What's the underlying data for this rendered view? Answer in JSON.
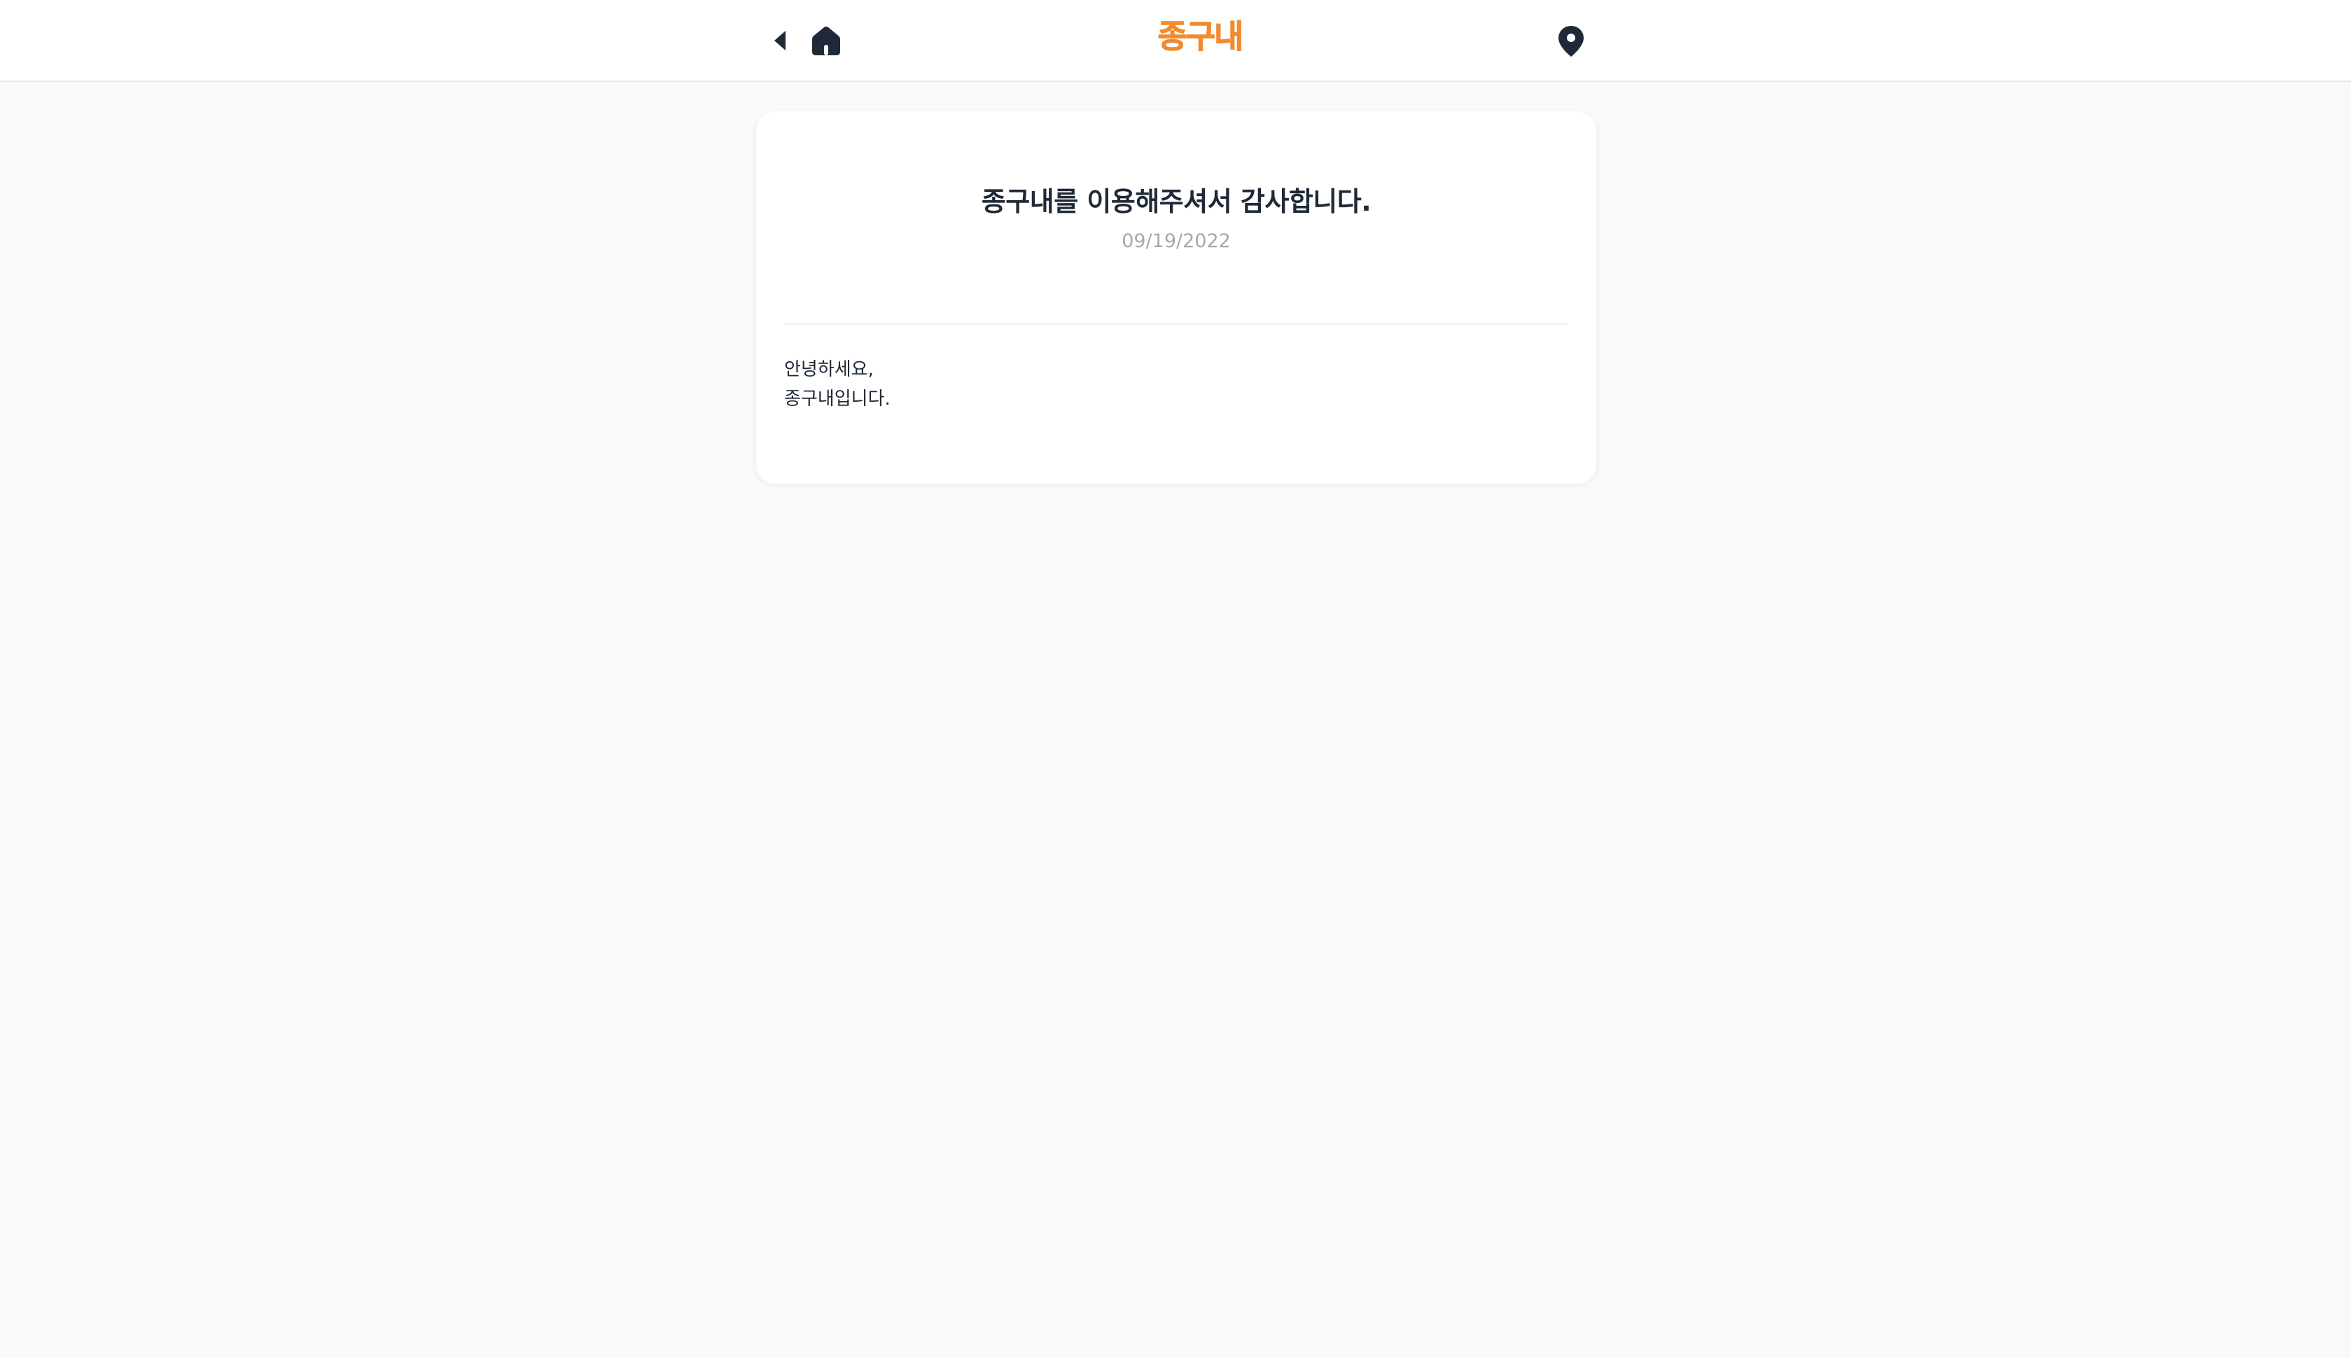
{
  "header": {
    "logo_text": "종구내",
    "icons": {
      "back": "caret-left-icon",
      "home": "home-icon",
      "location": "map-pin-icon"
    },
    "accent_color": "#f28a2f"
  },
  "notice": {
    "title": "종구내를 이용해주셔서 감사합니다.",
    "date": "09/19/2022",
    "body_lines": [
      "안녕하세요,",
      "종구내입니다."
    ]
  }
}
